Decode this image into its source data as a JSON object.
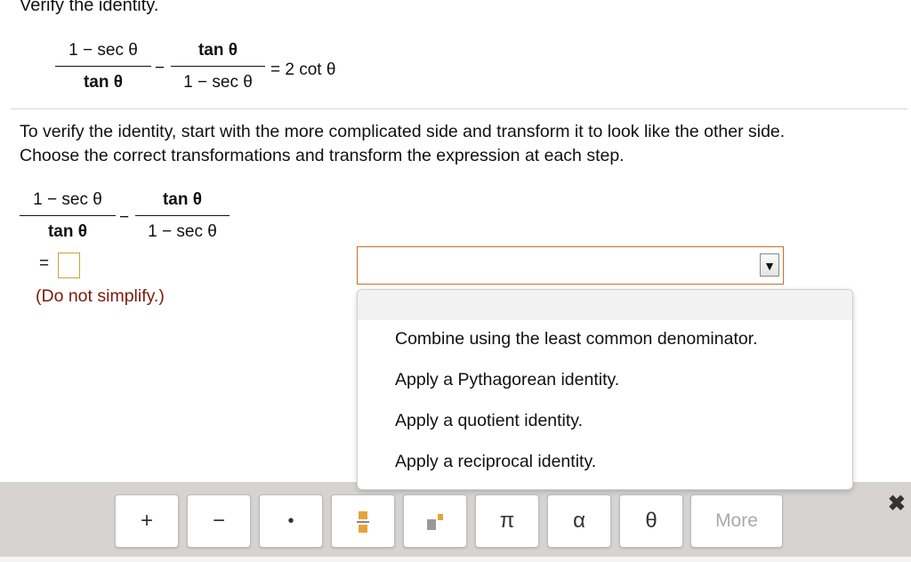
{
  "title": "Verify the identity.",
  "identity": {
    "left_num1": "1 − sec θ",
    "left_den1": "tan θ",
    "minus": "−",
    "left_num2": "tan θ",
    "left_den2": "1 − sec θ",
    "rhs": "= 2 cot θ"
  },
  "instructions": {
    "line1": "To verify the identity, start with the more complicated side and transform it to look like the other side.",
    "line2": "Choose the correct transformations and transform the expression at each step."
  },
  "work": {
    "num1": "1 − sec θ",
    "den1": "tan θ",
    "minus": "−",
    "num2": "tan θ",
    "den2": "1 − sec θ",
    "equals": "=",
    "note": "(Do not simplify.)"
  },
  "select": {
    "value": "",
    "arrow": "▼",
    "options": [
      "Combine using the least common denominator.",
      "Apply a Pythagorean identity.",
      "Apply a quotient identity.",
      "Apply a reciprocal identity."
    ]
  },
  "toolbar": {
    "buttons": [
      "+",
      "−",
      "•",
      "",
      "",
      "π",
      "α",
      "θ",
      "More"
    ],
    "close": "✖"
  },
  "colors": {
    "select_border": "#c86e2a",
    "answer_box_border": "#c8a23c",
    "note_text": "#7a1a0a",
    "toolbar_bg": "#d6d3d0",
    "fraction_icon_accent": "#e8a23c"
  }
}
